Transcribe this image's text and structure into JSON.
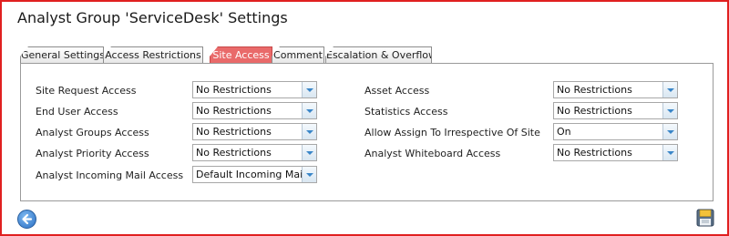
{
  "title": "Analyst Group 'ServiceDesk' Settings",
  "tabs": [
    {
      "label": "General Settings"
    },
    {
      "label": "Access Restrictions"
    },
    {
      "label": "Site Access"
    },
    {
      "label": "Comment"
    },
    {
      "label": "Escalation & Overflow"
    }
  ],
  "active_tab": "Site Access",
  "left_fields": [
    {
      "label": "Site Request Access",
      "value": "No Restrictions"
    },
    {
      "label": "End User Access",
      "value": "No Restrictions"
    },
    {
      "label": "Analyst Groups Access",
      "value": "No Restrictions"
    },
    {
      "label": "Analyst Priority Access",
      "value": "No Restrictions"
    },
    {
      "label": "Analyst Incoming Mail Access",
      "value": "Default Incoming Mail Or"
    }
  ],
  "right_fields": [
    {
      "label": "Asset Access",
      "value": "No Restrictions"
    },
    {
      "label": "Statistics Access",
      "value": "No Restrictions"
    },
    {
      "label": "Allow Assign To Irrespective Of Site",
      "value": "On"
    },
    {
      "label": "Analyst Whiteboard Access",
      "value": "No Restrictions"
    }
  ],
  "icons": {
    "back": "back-arrow-icon",
    "save": "floppy-disk-icon"
  },
  "colors": {
    "frame_border": "#e02020",
    "active_tab": "#e96a6a",
    "dropdown_arrow": "#3a86c8"
  }
}
